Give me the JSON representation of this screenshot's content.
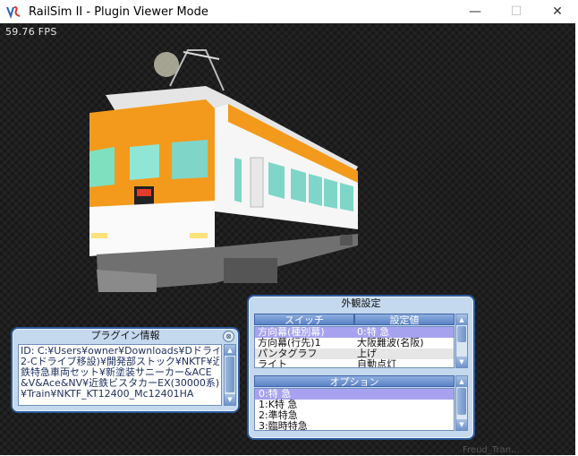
{
  "window": {
    "title": "RailSim II - Plugin Viewer Mode",
    "minimize_glyph": "—",
    "maximize_glyph": "☐",
    "close_glyph": "✕"
  },
  "viewport": {
    "fps_text": "59.76 FPS"
  },
  "plugin_info": {
    "title": "プラグイン情報",
    "close_glyph": "⊗",
    "lines": [
      "ID: C:¥Users¥owner¥Downloads¥Dドライブ(",
      "2-Cドライブ移設)¥開発部ストック¥NKTF¥近",
      "鉄特急車両セット¥新塗装サニーカー&ACE",
      "&V&Ace&NV¥近鉄ビスタカーEX(30000系)",
      "¥Train¥NKTF_KT12400_Mc12401HA"
    ]
  },
  "appearance": {
    "title": "外観設定",
    "col_switch": "スイッチ",
    "col_value": "設定値",
    "rows": [
      {
        "switch": "方向幕(種別幕)",
        "value": "0:特 急"
      },
      {
        "switch": "方向幕(行先)1",
        "value": "大阪難波(名阪)"
      },
      {
        "switch": "パンタグラフ",
        "value": "上げ"
      },
      {
        "switch": "ライト",
        "value": "自動点灯"
      }
    ],
    "options_header": "オプション",
    "options": [
      "0:特 急",
      "1:K特 急",
      "2:準特急",
      "3:臨時特急"
    ]
  },
  "background_ghost_text": "Freud_Tran...",
  "colors": {
    "train_orange": "#f39a1c",
    "train_white": "#f4f4f4",
    "dialog_border": "#2b5a9c",
    "selection": "#a7a2ef"
  }
}
